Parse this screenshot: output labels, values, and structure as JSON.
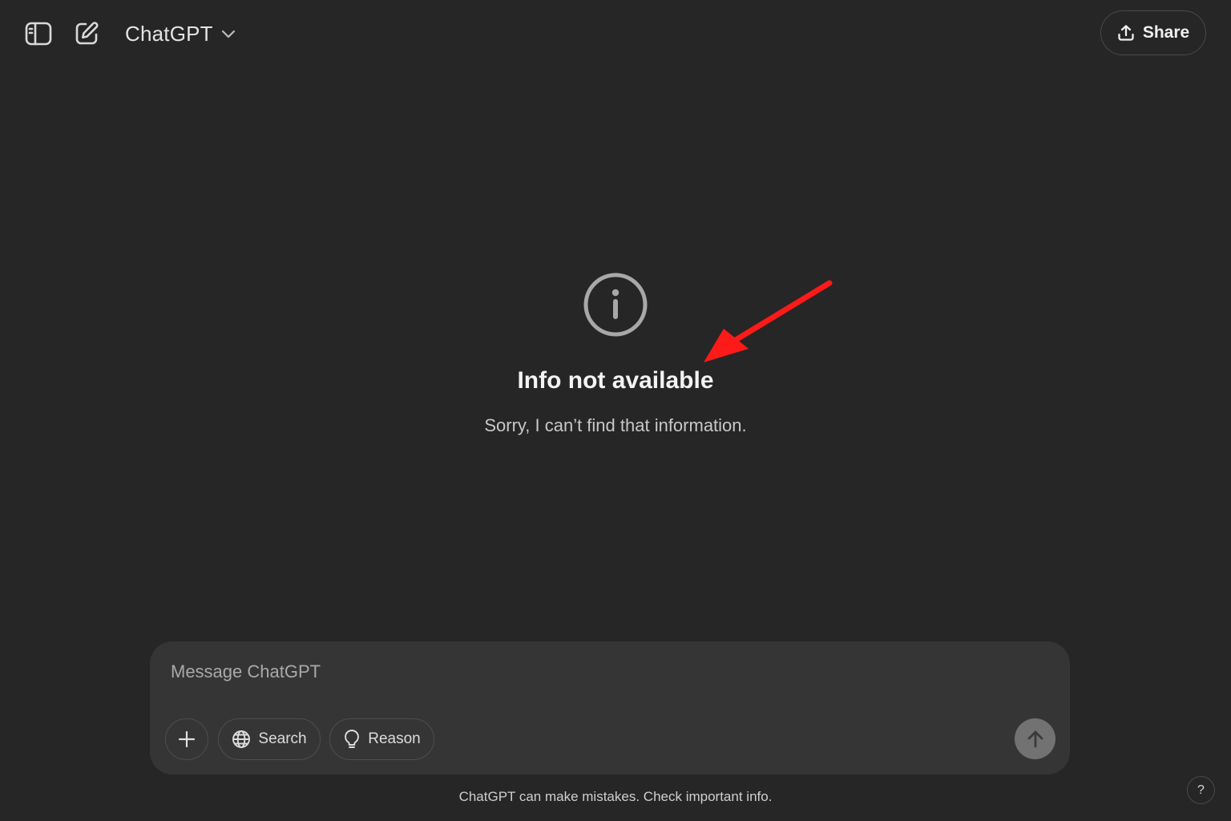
{
  "header": {
    "sidebar_toggle_icon": "sidebar-icon",
    "new_chat_icon": "compose-icon",
    "model_name": "ChatGPT",
    "model_chevron_icon": "chevron-down-icon",
    "share_label": "Share",
    "share_icon": "share-upload-icon"
  },
  "empty_state": {
    "icon": "info-circle-icon",
    "title": "Info not available",
    "subtitle": "Sorry, I can’t find that information."
  },
  "annotation": {
    "icon": "red-arrow-icon",
    "color": "#ff1a1a"
  },
  "composer": {
    "placeholder": "Message ChatGPT",
    "value": "",
    "attach_icon": "plus-icon",
    "search_label": "Search",
    "search_icon": "globe-icon",
    "reason_label": "Reason",
    "reason_icon": "lightbulb-icon",
    "send_icon": "arrow-up-icon"
  },
  "footer": {
    "disclaimer": "ChatGPT can make mistakes. Check important info.",
    "help_label": "?"
  },
  "colors": {
    "background": "#262626",
    "composer": "#353535",
    "send_button": "#727272",
    "arrow": "#ff1a1a"
  }
}
